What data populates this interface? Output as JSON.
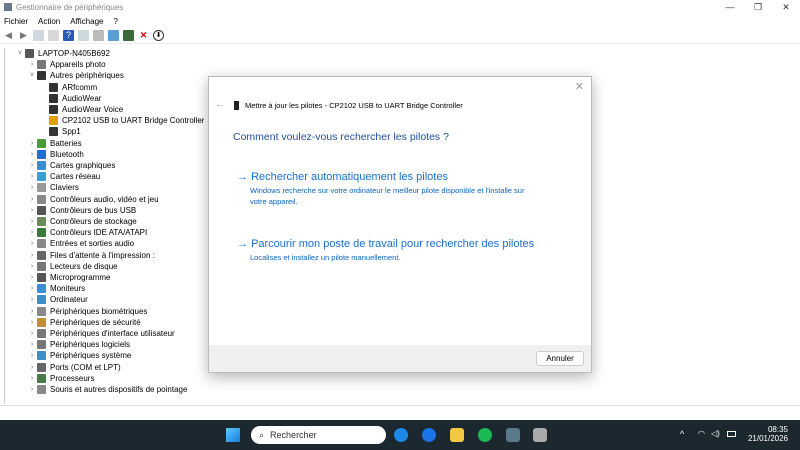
{
  "window": {
    "title": "Gestionnaire de périphériques",
    "controls": [
      "—",
      "❐",
      "✕"
    ]
  },
  "menu": [
    "Fichier",
    "Action",
    "Affichage",
    "?"
  ],
  "tree": {
    "root": "LAPTOP-N405B692",
    "items": [
      {
        "label": "Appareils photo",
        "expanded": false,
        "color": "#777"
      },
      {
        "label": "Autres périphériques",
        "expanded": true,
        "color": "#333",
        "children": [
          {
            "label": "ARfcomm",
            "color": "#333"
          },
          {
            "label": "AudioWear",
            "color": "#333"
          },
          {
            "label": "AudioWear Voice",
            "color": "#333"
          },
          {
            "label": "CP2102 USB to UART Bridge Controller",
            "color": "#e0a000"
          },
          {
            "label": "Spp1",
            "color": "#333"
          }
        ]
      },
      {
        "label": "Batteries",
        "color": "#4a9a3a"
      },
      {
        "label": "Bluetooth",
        "color": "#1e6fd9"
      },
      {
        "label": "Cartes graphiques",
        "color": "#3a8fd0"
      },
      {
        "label": "Cartes réseau",
        "color": "#3aa0d0"
      },
      {
        "label": "Claviers",
        "color": "#999"
      },
      {
        "label": "Contrôleurs audio, vidéo et jeu",
        "color": "#888"
      },
      {
        "label": "Contrôleurs de bus USB",
        "color": "#555"
      },
      {
        "label": "Contrôleurs de stockage",
        "color": "#6a8a5a"
      },
      {
        "label": "Contrôleurs IDE ATA/ATAPI",
        "color": "#3a7a3a"
      },
      {
        "label": "Entrées et sorties audio",
        "color": "#888"
      },
      {
        "label": "Files d'attente à l'impression :",
        "color": "#666"
      },
      {
        "label": "Lecteurs de disque",
        "color": "#777"
      },
      {
        "label": "Microprogramme",
        "color": "#555"
      },
      {
        "label": "Moniteurs",
        "color": "#3a8fd0"
      },
      {
        "label": "Ordinateur",
        "color": "#3a8fd0"
      },
      {
        "label": "Périphériques biométriques",
        "color": "#888"
      },
      {
        "label": "Périphériques de sécurité",
        "color": "#c09030"
      },
      {
        "label": "Périphériques d'interface utilisateur",
        "color": "#777"
      },
      {
        "label": "Périphériques logiciels",
        "color": "#777"
      },
      {
        "label": "Périphériques système",
        "color": "#3a8fd0"
      },
      {
        "label": "Ports (COM et LPT)",
        "color": "#666"
      },
      {
        "label": "Processeurs",
        "color": "#4a7a4a"
      },
      {
        "label": "Souris et autres dispositifs de pointage",
        "color": "#888"
      }
    ]
  },
  "dialog": {
    "header": "Mettre à jour les pilotes - CP2102 USB to UART Bridge Controller",
    "question": "Comment voulez-vous rechercher les pilotes ?",
    "options": [
      {
        "title": "Rechercher automatiquement les pilotes",
        "desc": "Windows recherche sur votre ordinateur le meilleur pilote disponible et l'installe sur votre appareil."
      },
      {
        "title": "Parcourir mon poste de travail pour rechercher des pilotes",
        "desc": "Localises et installez un pilote manuellement."
      }
    ],
    "cancel": "Annuler"
  },
  "taskbar": {
    "search_placeholder": "Rechercher",
    "time": "08:35",
    "date": "21/01/2026"
  },
  "colors": {
    "accent": "#1a6fd0",
    "taskbar": "#1b2830"
  }
}
